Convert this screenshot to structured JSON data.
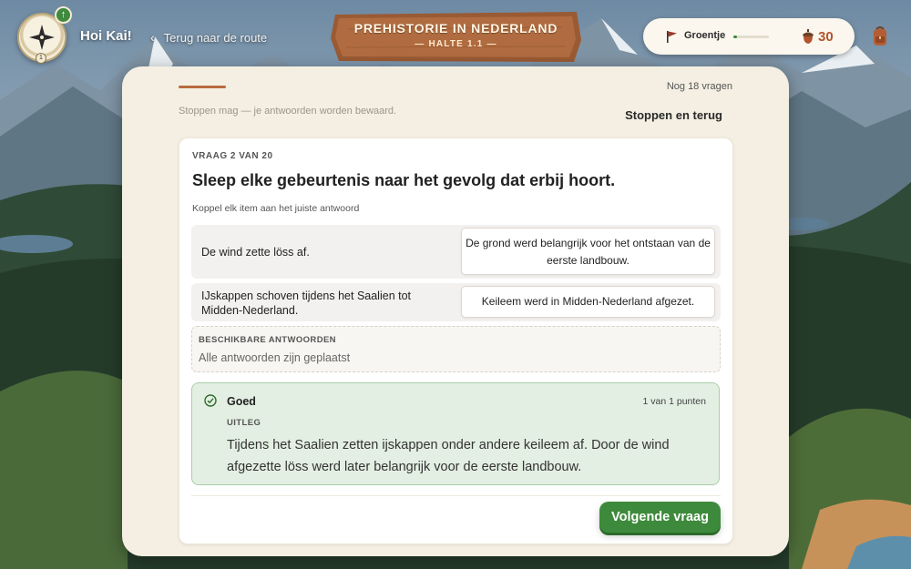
{
  "header": {
    "greeting": "Hoi Kai!",
    "back_label": "Terug naar de route",
    "compass_badge": "↑",
    "compass_level": "1",
    "sign_title": "PREHISTORIE IN NEDERLAND",
    "sign_subtitle": "— HALTE 1.1 —",
    "rank_label": "Groentje",
    "rank_progress": 0.1,
    "points": "30",
    "colors": {
      "accent_green": "#3e8a3c",
      "points_color": "#b3542f",
      "sign_wood": "#9a5a33"
    }
  },
  "quiz": {
    "progress_fraction": 0.05,
    "remaining": "Nog 18 vragen",
    "stop_hint": "Stoppen mag — je antwoorden worden bewaard.",
    "stop_button": "Stoppen en terug",
    "counter": "VRAAG 2 VAN 20",
    "title": "Sleep elke gebeurtenis naar het gevolg dat erbij hoort.",
    "instruction": "Koppel elk item aan het juiste antwoord",
    "pairs": [
      {
        "item": "De wind zette löss af.",
        "answer": "De grond werd belangrijk voor het ontstaan van de eerste landbouw."
      },
      {
        "item": "IJskappen schoven tijdens het Saalien tot Midden-Nederland.",
        "answer": "Keileem werd in Midden-Nederland afgezet."
      }
    ],
    "available_label": "BESCHIKBARE ANTWOORDEN",
    "available_value": "Alle antwoorden zijn geplaatst",
    "feedback": {
      "status": "Goed",
      "score": "1 van 1 punten",
      "explanation_label": "UITLEG",
      "explanation": "Tijdens het Saalien zetten ijskappen onder andere keileem af. Door de wind afgezette löss werd later belangrijk voor de eerste landbouw."
    },
    "next_button": "Volgende vraag"
  }
}
